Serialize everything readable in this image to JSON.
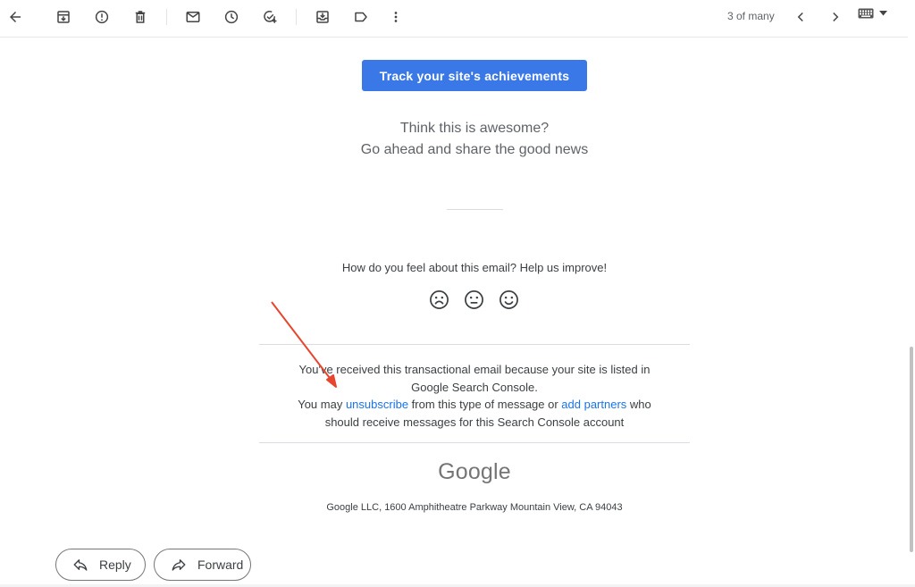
{
  "toolbar": {
    "back_icon": "arrow-left-icon",
    "actions": [
      "archive-icon",
      "report-spam-icon",
      "delete-icon",
      "mark-unread-icon",
      "snooze-icon",
      "add-task-icon",
      "move-to-icon",
      "label-icon",
      "more-vert-icon"
    ],
    "pager_text": "3 of many",
    "keyboard_icon": "keyboard-icon"
  },
  "email": {
    "cta_label": "Track your site's achievements",
    "share_line1": "Think this is awesome?",
    "share_line2": "Go ahead and share the good news",
    "feedback_question": "How do you feel about this email? Help us improve!",
    "faces": [
      "sad-face-icon",
      "neutral-face-icon",
      "happy-face-icon"
    ],
    "notice_line1": "You've received this transactional email because your site is listed in",
    "notice_line2": "Google Search Console.",
    "notice_pre": "You may ",
    "unsubscribe_link": "unsubscribe",
    "notice_mid": " from this type of message or ",
    "add_partners_link": "add partners",
    "notice_post": " who",
    "notice_line4": "should receive messages for this Search Console account",
    "logo_text": "Google",
    "address": "Google LLC, 1600 Amphitheatre Parkway Mountain View, CA 94043"
  },
  "actions": {
    "reply_label": "Reply",
    "forward_label": "Forward"
  },
  "colors": {
    "cta": "#3b78e7",
    "link": "#1a73e8",
    "annotation_arrow": "#e8452f"
  }
}
